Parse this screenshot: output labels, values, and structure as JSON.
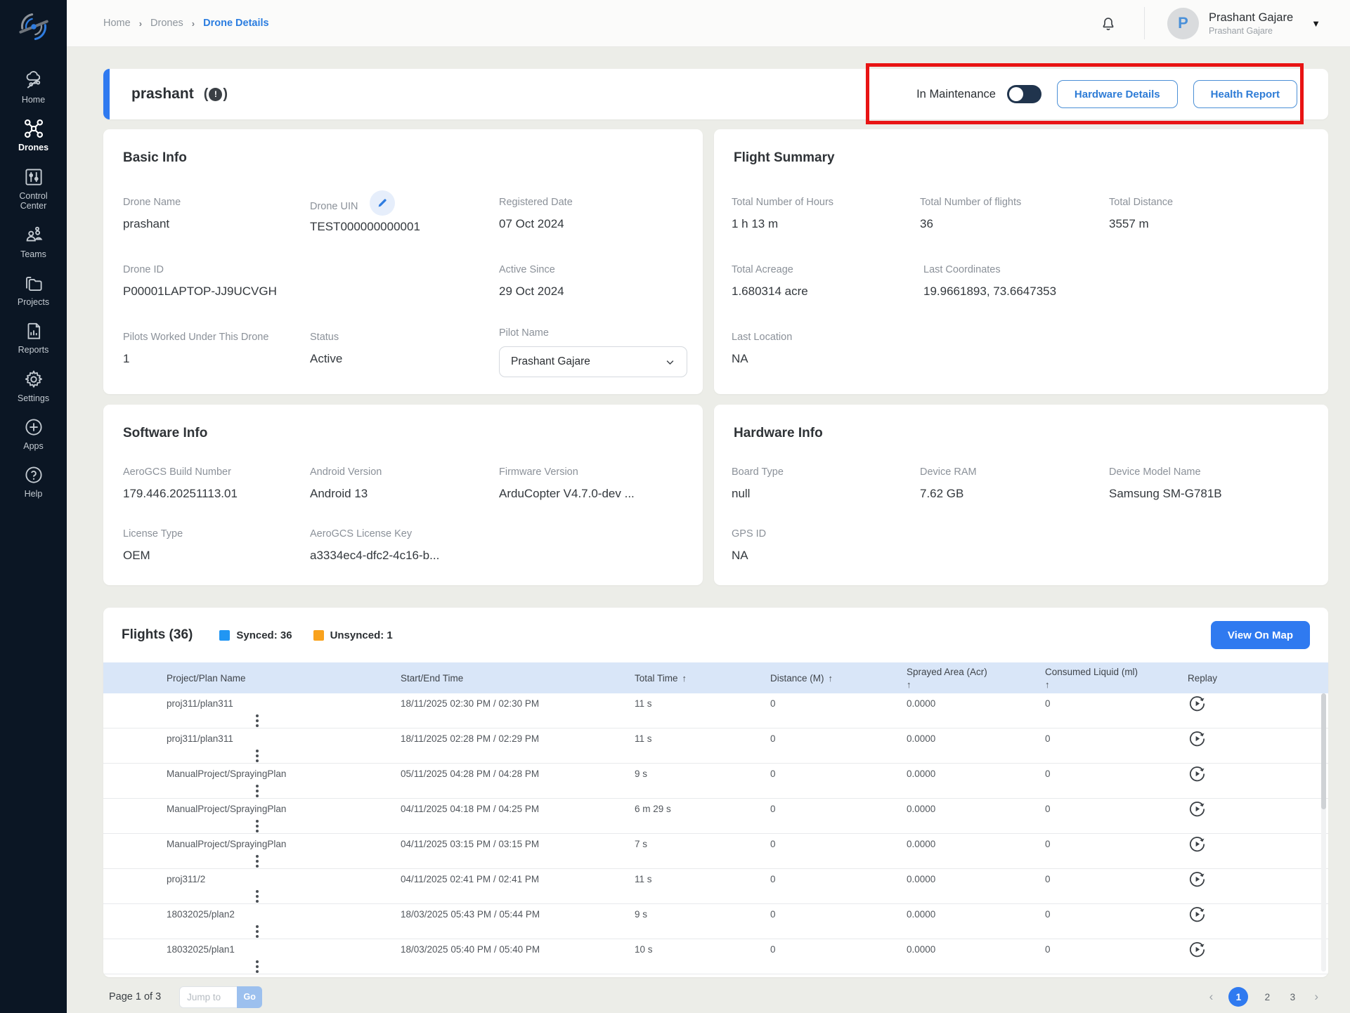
{
  "colors": {
    "accent": "#2f7af0",
    "synced": "#2196f3",
    "unsynced": "#f9a21d",
    "highlight": "#e81414",
    "sidebar_bg": "#0b1624"
  },
  "sidebar": {
    "items": [
      {
        "label": "Home"
      },
      {
        "label": "Drones"
      },
      {
        "label": "Control Center"
      },
      {
        "label": "Teams"
      },
      {
        "label": "Projects"
      },
      {
        "label": "Reports"
      },
      {
        "label": "Settings"
      },
      {
        "label": "Apps"
      },
      {
        "label": "Help"
      }
    ]
  },
  "topbar": {
    "breadcrumb": [
      {
        "label": "Home"
      },
      {
        "label": "Drones"
      },
      {
        "label": "Drone Details"
      }
    ],
    "user": {
      "initial": "P",
      "name": "Prashant Gajare",
      "subtitle": "Prashant Gajare"
    }
  },
  "header": {
    "title": "prashant",
    "maintenance_label": "In Maintenance",
    "hardware_details_label": "Hardware Details",
    "health_report_label": "Health Report"
  },
  "basic_info": {
    "title": "Basic Info",
    "fields": [
      {
        "label": "Drone Name",
        "value": "prashant"
      },
      {
        "label": "Drone UIN",
        "value": "TEST000000000001"
      },
      {
        "label": "Registered Date",
        "value": "07 Oct 2024"
      },
      {
        "label": "Drone ID",
        "value": "P00001LAPTOP-JJ9UCVGH"
      },
      {
        "label": "Active Since",
        "value": "29 Oct 2024"
      },
      {
        "label": "Pilots Worked Under This Drone",
        "value": "1"
      },
      {
        "label": "Status",
        "value": "Active"
      },
      {
        "label": "Pilot Name",
        "value": "Prashant Gajare"
      }
    ]
  },
  "flight_summary": {
    "title": "Flight Summary",
    "fields": [
      {
        "label": "Total Number of Hours",
        "value": "1 h 13 m"
      },
      {
        "label": "Total Number of flights",
        "value": "36"
      },
      {
        "label": "Total Distance",
        "value": "3557 m"
      },
      {
        "label": "Total Acreage",
        "value": "1.680314 acre"
      },
      {
        "label": "Last Coordinates",
        "value": "19.9661893, 73.6647353"
      },
      {
        "label": "Last Location",
        "value": "NA"
      }
    ]
  },
  "software_info": {
    "title": "Software Info",
    "fields": [
      {
        "label": "AeroGCS Build Number",
        "value": "179.446.20251113.01"
      },
      {
        "label": "Android Version",
        "value": "Android 13"
      },
      {
        "label": "Firmware Version",
        "value": "ArduCopter V4.7.0-dev ..."
      },
      {
        "label": "License Type",
        "value": "OEM"
      },
      {
        "label": "AeroGCS License Key",
        "value": "a3334ec4-dfc2-4c16-b..."
      }
    ]
  },
  "hardware_info": {
    "title": "Hardware Info",
    "fields": [
      {
        "label": "Board Type",
        "value": "null"
      },
      {
        "label": "Device RAM",
        "value": "7.62 GB"
      },
      {
        "label": "Device Model Name",
        "value": "Samsung SM-G781B"
      },
      {
        "label": "GPS ID",
        "value": "NA"
      }
    ]
  },
  "flights": {
    "title": "Flights (36)",
    "synced_label": "Synced: 36",
    "unsynced_label": "Unsynced: 1",
    "view_on_map_label": "View On Map",
    "columns": {
      "name": "Project/Plan Name",
      "time": "Start/End Time",
      "total": "Total Time",
      "distance": "Distance (M)",
      "sprayed": "Sprayed Area (Acr)",
      "consumed": "Consumed Liquid (ml)",
      "replay": "Replay"
    },
    "sort_arrow": "↑",
    "rows": [
      {
        "name": "proj311/plan311",
        "time": "18/11/2025 02:30 PM / 02:30 PM",
        "total": "11 s",
        "distance": "0",
        "sprayed": "0.0000",
        "consumed": "0"
      },
      {
        "name": "proj311/plan311",
        "time": "18/11/2025 02:28 PM / 02:29 PM",
        "total": "11 s",
        "distance": "0",
        "sprayed": "0.0000",
        "consumed": "0"
      },
      {
        "name": "ManualProject/SprayingPlan",
        "time": "05/11/2025 04:28 PM / 04:28 PM",
        "total": "9 s",
        "distance": "0",
        "sprayed": "0.0000",
        "consumed": "0"
      },
      {
        "name": "ManualProject/SprayingPlan",
        "time": "04/11/2025 04:18 PM / 04:25 PM",
        "total": "6 m 29 s",
        "distance": "0",
        "sprayed": "0.0000",
        "consumed": "0"
      },
      {
        "name": "ManualProject/SprayingPlan",
        "time": "04/11/2025 03:15 PM / 03:15 PM",
        "total": "7 s",
        "distance": "0",
        "sprayed": "0.0000",
        "consumed": "0"
      },
      {
        "name": "proj311/2",
        "time": "04/11/2025 02:41 PM / 02:41 PM",
        "total": "11 s",
        "distance": "0",
        "sprayed": "0.0000",
        "consumed": "0"
      },
      {
        "name": "18032025/plan2",
        "time": "18/03/2025 05:43 PM / 05:44 PM",
        "total": "9 s",
        "distance": "0",
        "sprayed": "0.0000",
        "consumed": "0"
      },
      {
        "name": "18032025/plan1",
        "time": "18/03/2025 05:40 PM / 05:40 PM",
        "total": "10 s",
        "distance": "0",
        "sprayed": "0.0000",
        "consumed": "0"
      }
    ],
    "pagination": {
      "page_label": "Page 1 of 3",
      "jump_placeholder": "Jump to",
      "go_label": "Go",
      "pages": [
        "1",
        "2",
        "3"
      ],
      "current": "1",
      "prev": "‹",
      "next": "›"
    }
  }
}
